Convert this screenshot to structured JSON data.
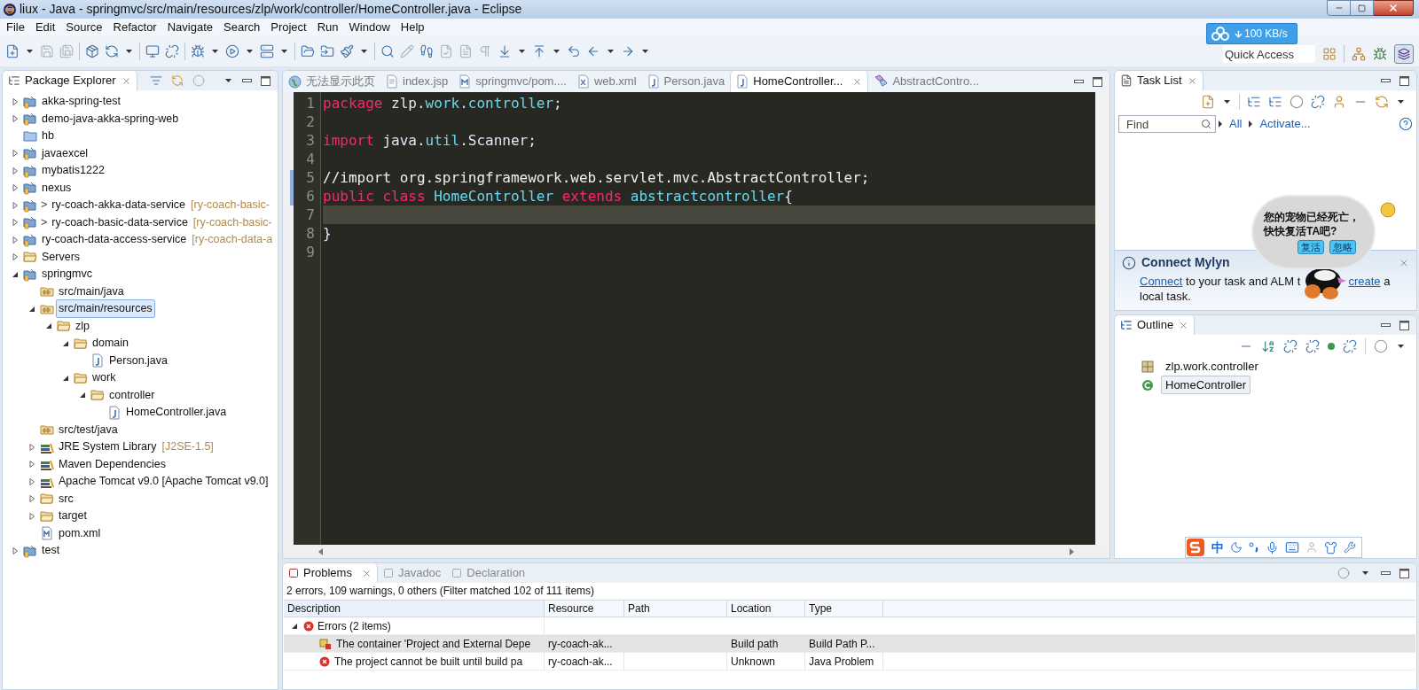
{
  "window": {
    "title": "liux - Java - springmvc/src/main/resources/zlp/work/controller/HomeController.java - Eclipse"
  },
  "menu": [
    "File",
    "Edit",
    "Source",
    "Refactor",
    "Navigate",
    "Search",
    "Project",
    "Run",
    "Window",
    "Help"
  ],
  "download_widget": {
    "speed": "100 KB/s"
  },
  "quick_access": {
    "placeholder": "Quick Access"
  },
  "package_explorer": {
    "title": "Package Explorer",
    "tree": [
      {
        "label": "akka-spring-test",
        "kind": "project",
        "expanded": false,
        "selected": false
      },
      {
        "label": "demo-java-akka-spring-web",
        "kind": "project",
        "expanded": false,
        "selected": false
      },
      {
        "label": "hb",
        "kind": "plain-folder",
        "selected": false
      },
      {
        "label": "javaexcel",
        "kind": "project",
        "expanded": false,
        "selected": false
      },
      {
        "label": "mybatis1222",
        "kind": "project",
        "expanded": false,
        "selected": false
      },
      {
        "label": "nexus",
        "kind": "project",
        "expanded": false,
        "selected": false
      },
      {
        "prefix": ">",
        "label": "ry-coach-akka-data-service",
        "suffix": "[ry-coach-basic-",
        "kind": "project",
        "expanded": false,
        "selected": false
      },
      {
        "prefix": ">",
        "label": "ry-coach-basic-data-service",
        "suffix": "[ry-coach-basic-",
        "kind": "project",
        "expanded": false,
        "selected": false
      },
      {
        "label": "ry-coach-data-access-service",
        "suffix": "[ry-coach-data-a",
        "kind": "project",
        "expanded": false,
        "selected": false
      },
      {
        "label": "Servers",
        "kind": "folder",
        "expanded": false,
        "selected": false
      },
      {
        "label": "springmvc",
        "kind": "project",
        "expanded": true,
        "selected": false,
        "children": [
          {
            "label": "src/main/java",
            "kind": "source-folder",
            "selected": false
          },
          {
            "label": "src/main/resources",
            "kind": "source-folder",
            "expanded": true,
            "selected": true,
            "children": [
              {
                "label": "zlp",
                "kind": "folder",
                "expanded": true,
                "selected": false,
                "children": [
                  {
                    "label": "domain",
                    "kind": "folder",
                    "expanded": true,
                    "selected": false,
                    "children": [
                      {
                        "label": "Person.java",
                        "kind": "java-file",
                        "selected": false
                      }
                    ]
                  },
                  {
                    "label": "work",
                    "kind": "folder",
                    "expanded": true,
                    "selected": false,
                    "children": [
                      {
                        "label": "controller",
                        "kind": "folder",
                        "expanded": true,
                        "selected": false,
                        "children": [
                          {
                            "label": "HomeController.java",
                            "kind": "java-file",
                            "selected": false
                          }
                        ]
                      }
                    ]
                  }
                ]
              }
            ]
          },
          {
            "label": "src/test/java",
            "kind": "source-folder",
            "selected": false
          },
          {
            "label": "JRE System Library",
            "suffix": "[J2SE-1.5]",
            "kind": "library",
            "expanded": false,
            "selected": false
          },
          {
            "label": "Maven Dependencies",
            "kind": "library",
            "expanded": false,
            "selected": false
          },
          {
            "label": "Apache Tomcat v9.0 [Apache Tomcat v9.0]",
            "kind": "library",
            "expanded": false,
            "selected": false
          },
          {
            "label": "src",
            "kind": "folder",
            "expanded": false,
            "selected": false
          },
          {
            "label": "target",
            "kind": "folder",
            "expanded": false,
            "selected": false
          },
          {
            "label": "pom.xml",
            "kind": "xml-file",
            "selected": false
          }
        ]
      },
      {
        "label": "test",
        "kind": "project",
        "expanded": false,
        "selected": false
      }
    ]
  },
  "editor": {
    "tabs": [
      {
        "label": "无法显示此页",
        "kind": "browser",
        "selected": false
      },
      {
        "label": "index.jsp",
        "kind": "page",
        "selected": false
      },
      {
        "label": "springmvc/pom....",
        "kind": "maven",
        "selected": false
      },
      {
        "label": "web.xml",
        "kind": "xml",
        "selected": false
      },
      {
        "label": "Person.java",
        "kind": "java",
        "selected": false
      },
      {
        "label": "HomeController...",
        "kind": "java",
        "selected": true
      },
      {
        "label": "AbstractContro...",
        "kind": "class",
        "selected": false
      }
    ],
    "lines": [
      {
        "number": "1",
        "current": false,
        "tokens": [
          {
            "text": "package",
            "kind": "keyword"
          },
          {
            "text": " zlp.",
            "kind": "plain"
          },
          {
            "text": "work",
            "kind": "name"
          },
          {
            "text": ".",
            "kind": "plain"
          },
          {
            "text": "controller",
            "kind": "name"
          },
          {
            "text": ";",
            "kind": "plain"
          }
        ]
      },
      {
        "number": "2",
        "current": false
      },
      {
        "number": "3",
        "current": false,
        "tokens": [
          {
            "text": "import",
            "kind": "keyword"
          },
          {
            "text": " java.",
            "kind": "plain"
          },
          {
            "text": "util",
            "kind": "name"
          },
          {
            "text": ".Scanner;",
            "kind": "plain"
          }
        ]
      },
      {
        "number": "4",
        "current": false
      },
      {
        "number": "5",
        "current": false,
        "tokens": [
          {
            "text": "//import org.springframework.web.servlet.mvc.AbstractController;",
            "kind": "comment"
          }
        ]
      },
      {
        "number": "6",
        "current": false,
        "tokens": [
          {
            "text": "public class",
            "kind": "keyword"
          },
          {
            "text": " HomeController",
            "kind": "name"
          },
          {
            "text": " extends",
            "kind": "keyword"
          },
          {
            "text": " abstractcontroller",
            "kind": "name"
          },
          {
            "text": "{",
            "kind": "plain"
          }
        ]
      },
      {
        "number": "7",
        "current": true
      },
      {
        "number": "8",
        "current": false,
        "tokens": [
          {
            "text": "}",
            "kind": "plain"
          }
        ]
      },
      {
        "number": "9",
        "current": false
      }
    ]
  },
  "task_list": {
    "title": "Task List",
    "find": {
      "placeholder": "Find"
    },
    "links": [
      "All",
      "Activate..."
    ]
  },
  "mylyn": {
    "title": "Connect Mylyn",
    "link_1": "Connect",
    "text_1": "to your task and ALM t",
    "link_2": "create",
    "text_2": "a local task."
  },
  "pet_bubble": {
    "lines": [
      "您的宠物已经死亡，",
      "快快复活TA吧?"
    ],
    "buttons": [
      "复活",
      "忽略"
    ]
  },
  "outline": {
    "title": "Outline",
    "items": [
      {
        "label": "zlp.work.controller",
        "kind": "package",
        "selected": false
      },
      {
        "label": "HomeController",
        "kind": "class",
        "selected": true
      }
    ]
  },
  "ime_bar": {
    "mode": "中"
  },
  "problems": {
    "tabs": [
      {
        "label": "Problems",
        "selected": true
      },
      {
        "label": "Javadoc",
        "selected": false
      },
      {
        "label": "Declaration",
        "selected": false
      }
    ],
    "summary": "2 errors, 109 warnings, 0 others (Filter matched 102 of 111 items)",
    "columns": [
      "Description",
      "Resource",
      "Path",
      "Location",
      "Type"
    ],
    "groups": [
      {
        "label": "Errors (2 items)",
        "expanded": true,
        "rows": [
          {
            "kind": "container-error",
            "selected": true,
            "cells": [
              "The container 'Project and External Depe",
              "ry-coach-ak...",
              null,
              "Build path",
              "Build Path P..."
            ]
          },
          {
            "kind": "error",
            "selected": false,
            "cells": [
              "The project cannot be built until build pa",
              "ry-coach-ak...",
              null,
              "Unknown",
              "Java Problem"
            ]
          }
        ]
      }
    ]
  }
}
